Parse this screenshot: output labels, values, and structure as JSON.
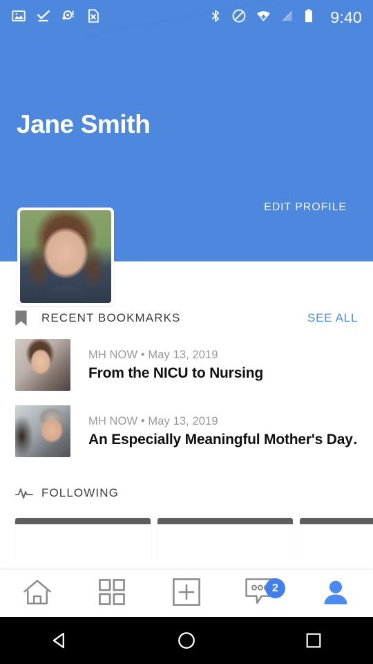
{
  "status_bar": {
    "time": "9:40",
    "left_icons": [
      "image-icon",
      "check-download-icon",
      "alarm-alert-icon",
      "document-error-icon"
    ],
    "right_icons": [
      "bluetooth-icon",
      "do-not-disturb-icon",
      "wifi-icon",
      "signal-off-icon",
      "battery-icon"
    ]
  },
  "header": {
    "profile_name": "Jane Smith",
    "edit_profile_label": "EDIT PROFILE",
    "background_color": "#4E88DE",
    "avatar_alt": "profile-photo"
  },
  "bookmarks_section": {
    "icon": "bookmark-icon",
    "title": "RECENT BOOKMARKS",
    "action_label": "SEE ALL",
    "action_color": "#4A8AF4",
    "items": [
      {
        "source": "MH NOW",
        "separator": "•",
        "date": "May 13, 2019",
        "meta": "MH NOW • May 13, 2019",
        "title": "From the NICU to Nursing",
        "thumbnail": "woman-smiling-thumbnail"
      },
      {
        "source": "MH NOW",
        "separator": "•",
        "date": "May 13, 2019",
        "meta": "MH NOW • May 13, 2019",
        "title": "An Especially Meaningful Mother's Day…",
        "thumbnail": "older-person-smiling-thumbnail"
      }
    ]
  },
  "following_section": {
    "icon": "activity-pulse-icon",
    "title": "FOLLOWING",
    "cards": [
      "card-1",
      "card-2",
      "card-3"
    ]
  },
  "bottom_nav": {
    "items": [
      {
        "name": "home",
        "icon": "home-icon",
        "active": false,
        "badge": ""
      },
      {
        "name": "grid",
        "icon": "grid-icon",
        "active": false,
        "badge": ""
      },
      {
        "name": "add",
        "icon": "plus-square-icon",
        "active": false,
        "badge": ""
      },
      {
        "name": "messages",
        "icon": "chat-bubble-icon",
        "active": false,
        "badge": "2"
      },
      {
        "name": "profile",
        "icon": "person-icon",
        "active": true,
        "badge": ""
      }
    ],
    "badge_color": "#3F7FF0",
    "active_color": "#4A8AF4"
  },
  "system_nav": {
    "back": "back-triangle-icon",
    "home": "home-circle-icon",
    "recents": "recents-square-icon"
  }
}
